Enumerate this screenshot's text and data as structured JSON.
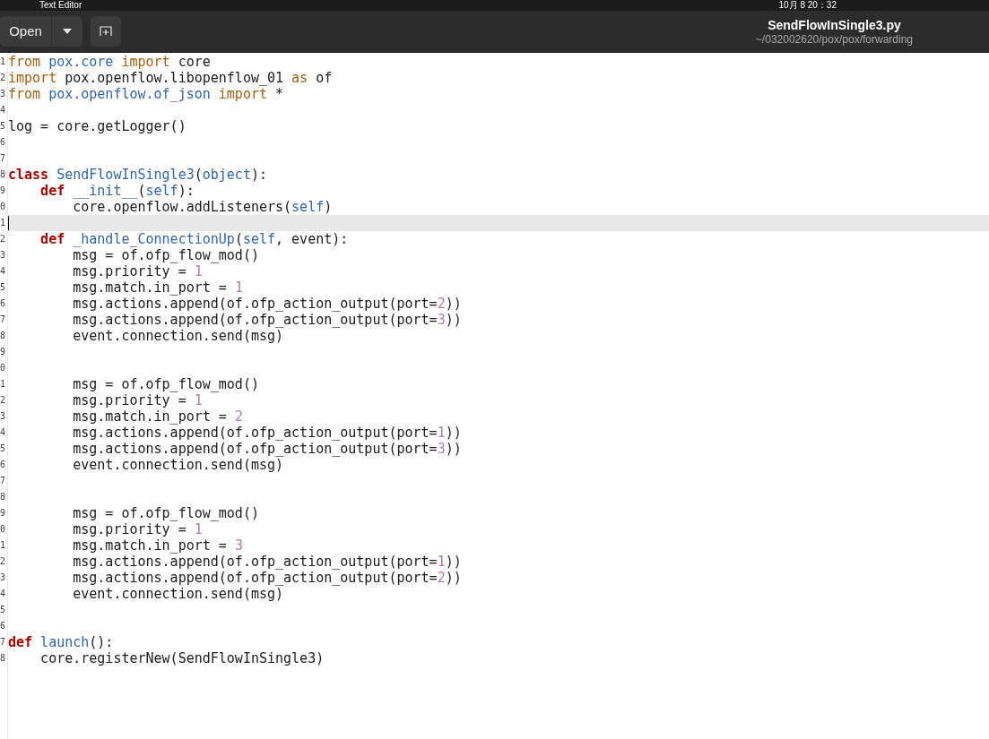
{
  "top_panel": {
    "app_menu": "Text Editor",
    "clock": "10月 8 20：32"
  },
  "header": {
    "open_button": "Open",
    "title": "SendFlowInSingle3.py",
    "subtitle": "~/032002620/pox/pox/forwarding"
  },
  "editor": {
    "lines": [
      {
        "number": "1",
        "tokens": [
          {
            "kind": "keyword",
            "text": "from"
          },
          {
            "kind": "name",
            "text": " pox.core "
          },
          {
            "kind": "keyword",
            "text": "import"
          },
          {
            "kind": "plain",
            "text": " core"
          }
        ]
      },
      {
        "number": "2",
        "tokens": [
          {
            "kind": "keyword",
            "text": "import"
          },
          {
            "kind": "plain",
            "text": " pox.openflow.libopenflow_01 "
          },
          {
            "kind": "keyword",
            "text": "as"
          },
          {
            "kind": "plain",
            "text": " of"
          }
        ]
      },
      {
        "number": "3",
        "tokens": [
          {
            "kind": "keyword",
            "text": "from"
          },
          {
            "kind": "name",
            "text": " pox.openflow.of_json "
          },
          {
            "kind": "keyword",
            "text": "import"
          },
          {
            "kind": "plain",
            "text": " *"
          }
        ]
      },
      {
        "number": "4"
      },
      {
        "number": "5",
        "tokens": [
          {
            "kind": "plain",
            "text": "log = core.getLogger()"
          }
        ]
      },
      {
        "number": "6"
      },
      {
        "number": "7"
      },
      {
        "number": "8",
        "tokens": [
          {
            "kind": "statement",
            "text": "class"
          },
          {
            "kind": "name",
            "text": " SendFlowInSingle3"
          },
          {
            "kind": "plain",
            "text": "("
          },
          {
            "kind": "name",
            "text": "object"
          },
          {
            "kind": "plain",
            "text": "):"
          }
        ]
      },
      {
        "number": "9",
        "tokens": [
          {
            "kind": "statement",
            "text": "    def"
          },
          {
            "kind": "name",
            "text": " __init__"
          },
          {
            "kind": "plain",
            "text": "("
          },
          {
            "kind": "name",
            "text": "self"
          },
          {
            "kind": "plain",
            "text": "):"
          }
        ]
      },
      {
        "number": "0",
        "tokens": [
          {
            "kind": "plain",
            "text": "        core.openflow.addListeners("
          },
          {
            "kind": "name",
            "text": "self"
          },
          {
            "kind": "plain",
            "text": ")"
          }
        ]
      },
      {
        "number": "1",
        "current": true
      },
      {
        "number": "2",
        "tokens": [
          {
            "kind": "statement",
            "text": "    def"
          },
          {
            "kind": "name",
            "text": " _handle_ConnectionUp"
          },
          {
            "kind": "plain",
            "text": "("
          },
          {
            "kind": "name",
            "text": "self"
          },
          {
            "kind": "plain",
            "text": ", event):"
          }
        ]
      },
      {
        "number": "3",
        "tokens": [
          {
            "kind": "plain",
            "text": "        msg = of.ofp_flow_mod()"
          }
        ]
      },
      {
        "number": "4",
        "tokens": [
          {
            "kind": "plain",
            "text": "        msg.priority = "
          },
          {
            "kind": "number",
            "text": "1"
          }
        ]
      },
      {
        "number": "5",
        "tokens": [
          {
            "kind": "plain",
            "text": "        msg.match.in_port = "
          },
          {
            "kind": "number",
            "text": "1"
          }
        ]
      },
      {
        "number": "6",
        "tokens": [
          {
            "kind": "plain",
            "text": "        msg.actions.append(of.ofp_action_output(port="
          },
          {
            "kind": "number",
            "text": "2"
          },
          {
            "kind": "plain",
            "text": "))"
          }
        ]
      },
      {
        "number": "7",
        "tokens": [
          {
            "kind": "plain",
            "text": "        msg.actions.append(of.ofp_action_output(port="
          },
          {
            "kind": "number",
            "text": "3"
          },
          {
            "kind": "plain",
            "text": "))"
          }
        ]
      },
      {
        "number": "8",
        "tokens": [
          {
            "kind": "plain",
            "text": "        event.connection.send(msg)"
          }
        ]
      },
      {
        "number": "9"
      },
      {
        "number": "0"
      },
      {
        "number": "1",
        "tokens": [
          {
            "kind": "plain",
            "text": "        msg = of.ofp_flow_mod()"
          }
        ]
      },
      {
        "number": "2",
        "tokens": [
          {
            "kind": "plain",
            "text": "        msg.priority = "
          },
          {
            "kind": "number",
            "text": "1"
          }
        ]
      },
      {
        "number": "3",
        "tokens": [
          {
            "kind": "plain",
            "text": "        msg.match.in_port = "
          },
          {
            "kind": "number",
            "text": "2"
          }
        ]
      },
      {
        "number": "4",
        "tokens": [
          {
            "kind": "plain",
            "text": "        msg.actions.append(of.ofp_action_output(port="
          },
          {
            "kind": "number",
            "text": "1"
          },
          {
            "kind": "plain",
            "text": "))"
          }
        ]
      },
      {
        "number": "5",
        "tokens": [
          {
            "kind": "plain",
            "text": "        msg.actions.append(of.ofp_action_output(port="
          },
          {
            "kind": "number",
            "text": "3"
          },
          {
            "kind": "plain",
            "text": "))"
          }
        ]
      },
      {
        "number": "6",
        "tokens": [
          {
            "kind": "plain",
            "text": "        event.connection.send(msg)"
          }
        ]
      },
      {
        "number": "7"
      },
      {
        "number": "8"
      },
      {
        "number": "9",
        "tokens": [
          {
            "kind": "plain",
            "text": "        msg = of.ofp_flow_mod()"
          }
        ]
      },
      {
        "number": "0",
        "tokens": [
          {
            "kind": "plain",
            "text": "        msg.priority = "
          },
          {
            "kind": "number",
            "text": "1"
          }
        ]
      },
      {
        "number": "1",
        "tokens": [
          {
            "kind": "plain",
            "text": "        msg.match.in_port = "
          },
          {
            "kind": "number",
            "text": "3"
          }
        ]
      },
      {
        "number": "2",
        "tokens": [
          {
            "kind": "plain",
            "text": "        msg.actions.append(of.ofp_action_output(port="
          },
          {
            "kind": "number",
            "text": "1"
          },
          {
            "kind": "plain",
            "text": "))"
          }
        ]
      },
      {
        "number": "3",
        "tokens": [
          {
            "kind": "plain",
            "text": "        msg.actions.append(of.ofp_action_output(port="
          },
          {
            "kind": "number",
            "text": "2"
          },
          {
            "kind": "plain",
            "text": "))"
          }
        ]
      },
      {
        "number": "4",
        "tokens": [
          {
            "kind": "plain",
            "text": "        event.connection.send(msg)"
          }
        ]
      },
      {
        "number": "5"
      },
      {
        "number": "6"
      },
      {
        "number": "7",
        "tokens": [
          {
            "kind": "statement",
            "text": "def"
          },
          {
            "kind": "name",
            "text": " launch"
          },
          {
            "kind": "plain",
            "text": "():"
          }
        ]
      },
      {
        "number": "8",
        "tokens": [
          {
            "kind": "plain",
            "text": "    core.registerNew(SendFlowInSingle3)"
          }
        ]
      }
    ]
  }
}
